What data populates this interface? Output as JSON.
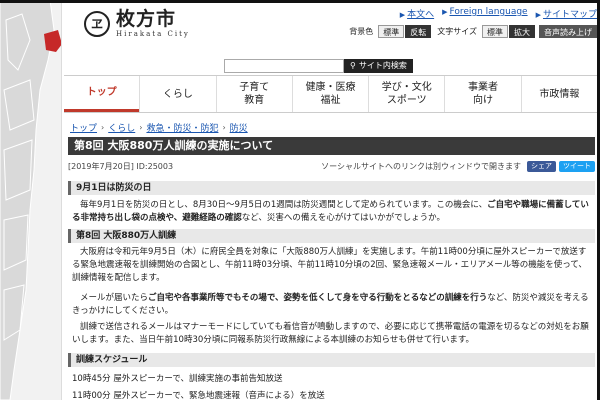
{
  "header": {
    "logo_mark": "ヱ",
    "city_name": "枚方市",
    "city_name_romaji": "Hirakata City",
    "top_links": [
      "本文へ",
      "Foreign language",
      "サイトマップ"
    ],
    "background_color_label": "背景色",
    "bg_standard": "標準",
    "bg_inverted": "反転",
    "font_size_label": "文字サイズ",
    "fs_standard": "標準",
    "fs_large": "拡大",
    "voice_button": "音声読み上げ",
    "search_button": "サイト内検索"
  },
  "nav": {
    "items": [
      {
        "label": "トップ",
        "active": true
      },
      {
        "label": "くらし",
        "active": false
      },
      {
        "label": "子育て\n教育",
        "active": false
      },
      {
        "label": "健康・医療\n福祉",
        "active": false
      },
      {
        "label": "学び・文化\nスポーツ",
        "active": false
      },
      {
        "label": "事業者\n向け",
        "active": false
      },
      {
        "label": "市政情報",
        "active": false
      }
    ]
  },
  "breadcrumb": [
    "トップ",
    "くらし",
    "救急・防災・防犯",
    "防災"
  ],
  "page": {
    "title": "第8回 大阪880万人訓練の実施について",
    "date_id": "[2019年7月20日]  ID:25003",
    "external_note": "ソーシャルサイトへのリンクは別ウィンドウで開きます",
    "share_label": "シェア",
    "tweet_label": "ツイート"
  },
  "section1": {
    "heading": "9月1日は防災の日",
    "para_a": "毎年9月1日を防災の日とし、8月30日～9月5日の1週間は防災週間として定められています。この機会に、",
    "para_bold": "ご自宅や職場に備蓄している非常持ち出し袋の点検や、避難経路の確認",
    "para_b": "など、災害への備えを心がけてはいかがでしょうか。"
  },
  "section2": {
    "heading": "第8回 大阪880万人訓練",
    "para1": "大阪府は令和元年9月5日（木）に府民全員を対象に「大阪880万人訓練」を実施します。午前11時00分頃に屋外スピーカーで放送する緊急地震速報を訓練開始の合図とし、午前11時03分頃、午前11時10分頃の2回、緊急速報メール・エリアメール等の機能を使って、訓練情報を配信します。",
    "para2_a": "メールが届いたら",
    "para2_bold": "ご自宅や各事業所等でもその場で、姿勢を低くして身を守る行動をとるなどの訓練を行う",
    "para2_b": "など、防災や減災を考えるきっかけにしてください。",
    "para3": "訓練で送信されるメールはマナーモードにしていても着信音が鳴動しますので、必要に応じて携帯電話の電源を切るなどの対処をお願いします。また、当日午前10時30分頃に同報系防災行政無線による本訓練のお知らせも併せて行います。"
  },
  "section3": {
    "heading": "訓練スケジュール",
    "lines": [
      "10時45分  屋外スピーカーで、訓練実施の事前告知放送",
      "11時00分  屋外スピーカーで、緊急地震速報（音声による）を放送"
    ]
  },
  "colors": {
    "accent_red": "#c0392b",
    "title_bar": "#3a3a3a",
    "link_blue": "#1a56b0"
  }
}
